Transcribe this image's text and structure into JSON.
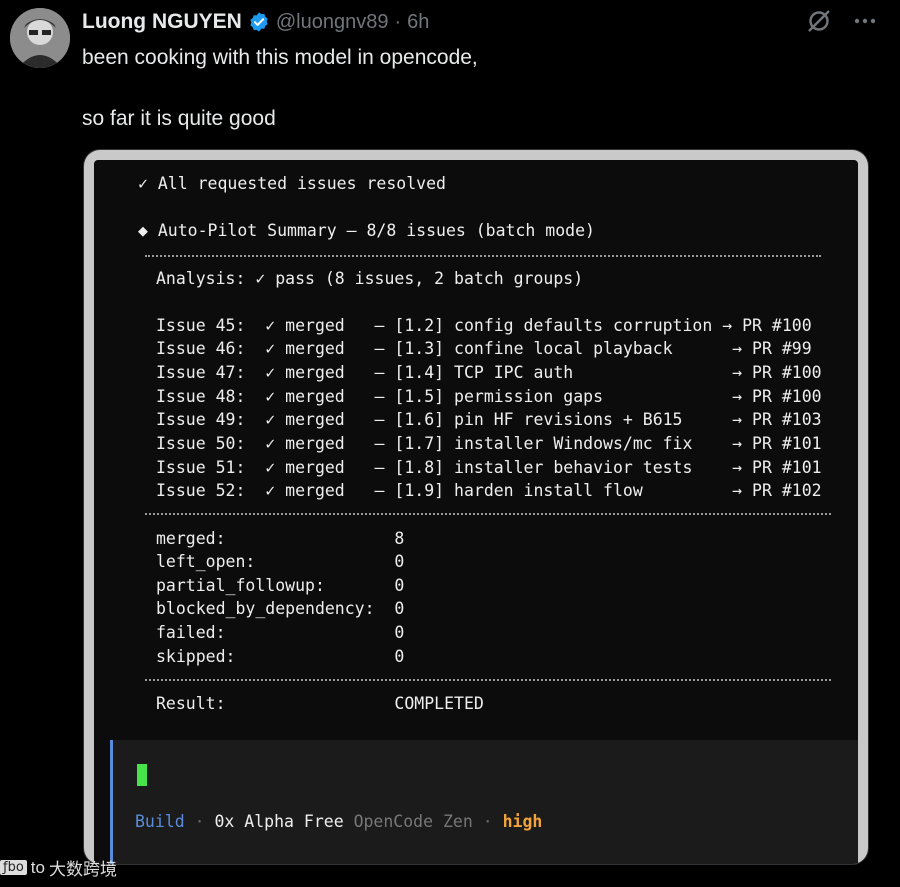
{
  "tweet": {
    "author_name": "Luong NGUYEN",
    "handle": "@luongnv89",
    "separator": "·",
    "time": "6h",
    "text_line1": "been cooking with this model in opencode,",
    "text_line2": "so far it is quite good"
  },
  "icons": {
    "verified": "verified-badge-icon",
    "grok": "grok-icon",
    "more": "more-icon"
  },
  "terminal": {
    "resolved": "✓ All requested issues resolved",
    "summary": "◆ Auto-Pilot Summary — 8/8 issues (batch mode)",
    "analysis": "Analysis: ✓ pass (8 issues, 2 batch groups)",
    "issues": [
      "Issue 45:  ✓ merged   — [1.2] config defaults corruption → PR #100",
      "Issue 46:  ✓ merged   — [1.3] confine local playback      → PR #99",
      "Issue 47:  ✓ merged   — [1.4] TCP IPC auth                → PR #100",
      "Issue 48:  ✓ merged   — [1.5] permission gaps             → PR #100",
      "Issue 49:  ✓ merged   — [1.6] pin HF revisions + B615     → PR #103",
      "Issue 50:  ✓ merged   — [1.7] installer Windows/mc fix    → PR #101",
      "Issue 51:  ✓ merged   — [1.8] installer behavior tests    → PR #101",
      "Issue 52:  ✓ merged   — [1.9] harden install flow         → PR #102"
    ],
    "stats": [
      "merged:                 8",
      "left_open:              0",
      "partial_followup:       0",
      "blocked_by_dependency:  0",
      "failed:                 0",
      "skipped:                0"
    ],
    "result": "Result:                 COMPLETED"
  },
  "status_bar": {
    "mode": "Build",
    "dot": "·",
    "model": "0x Alpha Free",
    "provider": "OpenCode Zen",
    "effort": "high"
  },
  "watermark": {
    "logo": "ƒbo",
    "prefix": "to",
    "text": "大数跨境"
  },
  "colors": {
    "background": "#000000",
    "accent_blue": "#5a8cdb",
    "cursor_green": "#46e34a",
    "effort_orange": "#f2a33a",
    "verified_blue": "#1d9bf0"
  }
}
